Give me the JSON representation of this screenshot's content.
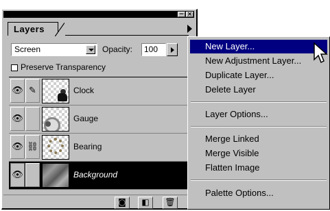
{
  "palette": {
    "tab_label": "Layers",
    "blend_mode": "Screen",
    "opacity_label": "Opacity:",
    "opacity_value": "100",
    "preserve_label": "Preserve Transparency",
    "layers": [
      {
        "name": "Clock",
        "link_glyph": "brush",
        "selected": false
      },
      {
        "name": "Gauge",
        "link_glyph": "",
        "selected": false
      },
      {
        "name": "Bearing",
        "link_glyph": "chain",
        "selected": false
      },
      {
        "name": "Background",
        "link_glyph": "",
        "selected": true
      }
    ],
    "icons": {
      "eye": "eye-icon",
      "brush": "paintbrush-icon",
      "chain": "link-icon",
      "mask": "mask-icon",
      "new_layer": "new-layer-icon",
      "trash": "trash-icon"
    }
  },
  "menu": {
    "items": [
      {
        "label": "New Layer...",
        "highlighted": true
      },
      {
        "label": "New Adjustment Layer...",
        "highlighted": false
      },
      {
        "label": "Duplicate Layer...",
        "highlighted": false
      },
      {
        "label": "Delete Layer",
        "highlighted": false
      },
      {
        "label": "Layer Options...",
        "highlighted": false
      },
      {
        "label": "Merge Linked",
        "highlighted": false
      },
      {
        "label": "Merge Visible",
        "highlighted": false
      },
      {
        "label": "Flatten Image",
        "highlighted": false
      },
      {
        "label": "Palette Options...",
        "highlighted": false
      }
    ]
  },
  "colors": {
    "face": "#c0c0c0",
    "highlight": "#000080",
    "selected_row": "#000000"
  }
}
